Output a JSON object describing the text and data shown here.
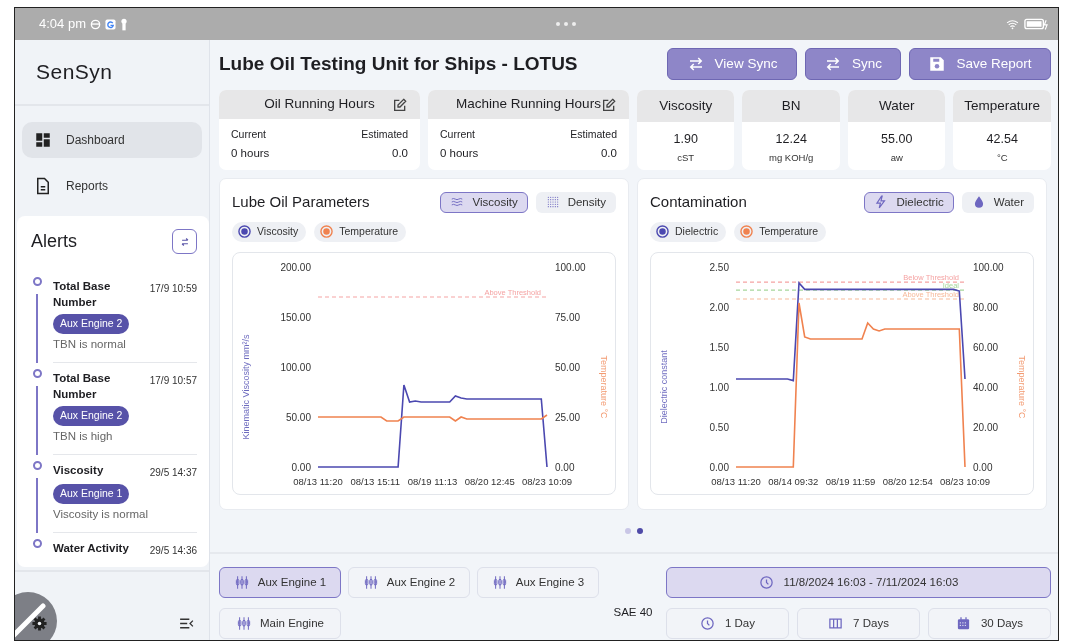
{
  "status_bar": {
    "time": "4:04 pm"
  },
  "sidebar": {
    "logo": "SenSyn",
    "nav": [
      {
        "label": "Dashboard",
        "selected": true
      },
      {
        "label": "Reports",
        "selected": false
      }
    ],
    "alerts": {
      "title": "Alerts",
      "items": [
        {
          "title": "Total Base Number",
          "time": "17/9 10:59",
          "tag": "Aux Engine 2",
          "message": "TBN is normal"
        },
        {
          "title": "Total Base Number",
          "time": "17/9 10:57",
          "tag": "Aux Engine 2",
          "message": "TBN is high"
        },
        {
          "title": "Viscosity",
          "time": "29/5 14:37",
          "tag": "Aux Engine 1",
          "message": "Viscosity is normal"
        },
        {
          "title": "Water Activity",
          "time": "29/5 14:36"
        }
      ]
    }
  },
  "header": {
    "title": "Lube Oil Testing Unit for Ships - LOTUS",
    "buttons": [
      {
        "label": "View Sync"
      },
      {
        "label": "Sync"
      },
      {
        "label": "Save Report"
      }
    ]
  },
  "hours_cards": [
    {
      "title": "Oil Running Hours",
      "current_label": "Current",
      "current": "0 hours",
      "estimated_label": "Estimated",
      "estimated": "0.0"
    },
    {
      "title": "Machine Running Hours",
      "current_label": "Current",
      "current": "0 hours",
      "estimated_label": "Estimated",
      "estimated": "0.0"
    }
  ],
  "metrics": [
    {
      "title": "Viscosity",
      "value": "1.90",
      "unit": "cST"
    },
    {
      "title": "BN",
      "value": "12.24",
      "unit": "mg KOH/g"
    },
    {
      "title": "Water",
      "value": "55.00",
      "unit": "aw"
    },
    {
      "title": "Temperature",
      "value": "42.54",
      "unit": "°C"
    }
  ],
  "charts": [
    {
      "title": "Lube Oil Parameters",
      "toggles": [
        {
          "label": "Viscosity",
          "selected": true
        },
        {
          "label": "Density",
          "selected": false
        }
      ],
      "chart_data": {
        "type": "line",
        "ylabel": "Kinematic Viscosity mm²/s",
        "y2label": "Temperature °C",
        "ylim": [
          0,
          200
        ],
        "y2lim": [
          0,
          100
        ],
        "categories": [
          "08/13 11:20",
          null,
          null,
          null,
          null,
          null,
          null,
          null,
          null,
          null,
          "08/13 15:11",
          null,
          null,
          null,
          null,
          null,
          null,
          null,
          null,
          null,
          "08/19 11:13",
          null,
          null,
          null,
          null,
          null,
          null,
          null,
          null,
          null,
          "08/20 12:45",
          null,
          null,
          null,
          null,
          null,
          null,
          null,
          null,
          null,
          "08/23 10:09"
        ],
        "yticks": [
          {
            "value": 0,
            "label": "0.00"
          },
          {
            "value": 50,
            "label": "50.00"
          },
          {
            "value": 100,
            "label": "100.00"
          },
          {
            "value": 150,
            "label": "150.00"
          },
          {
            "value": 200,
            "label": "200.00"
          }
        ],
        "y2ticks": [
          {
            "value": 0,
            "label": "0.00"
          },
          {
            "value": 25,
            "label": "25.00"
          },
          {
            "value": 50,
            "label": "50.00"
          },
          {
            "value": 75,
            "label": "75.00"
          },
          {
            "value": 100,
            "label": "100.00"
          }
        ],
        "series": [
          {
            "name": "Viscosity",
            "color": "#4b48b0",
            "values": [
              0,
              0,
              0,
              0,
              0,
              0,
              0,
              0,
              0,
              0,
              0,
              0,
              0,
              0,
              0,
              82,
              65,
              66,
              65,
              65,
              65,
              65,
              65,
              65,
              71,
              69,
              68,
              68,
              68,
              68,
              68,
              68,
              68,
              68,
              68,
              68,
              68,
              68,
              68,
              68,
              0
            ]
          },
          {
            "name": "Temperature",
            "color": "#f0824f",
            "axis": "y2",
            "values": [
              25,
              25,
              25,
              25,
              25,
              25,
              25,
              25,
              25,
              25,
              25,
              25,
              23,
              23,
              23,
              25,
              25,
              25,
              25,
              25,
              25,
              25,
              25,
              25,
              23,
              25,
              24,
              24,
              24,
              24,
              24,
              24,
              24,
              24,
              24,
              24,
              24,
              24,
              24,
              24,
              26
            ]
          }
        ],
        "ref_lines": [
          {
            "axis": "y",
            "value": 170,
            "label": "Above Threshold",
            "color": "#f5a3a3"
          }
        ]
      }
    },
    {
      "title": "Contamination",
      "toggles": [
        {
          "label": "Dielectric",
          "selected": true
        },
        {
          "label": "Water",
          "selected": false
        }
      ],
      "chart_data": {
        "type": "line",
        "ylabel": "Dielectric constant",
        "y2label": "Temperature °C",
        "ylim": [
          0,
          2.5
        ],
        "y2lim": [
          0,
          100
        ],
        "categories": [
          "08/13 11:20",
          null,
          null,
          null,
          null,
          null,
          null,
          null,
          null,
          null,
          "08/14 09:32",
          null,
          null,
          null,
          null,
          null,
          null,
          null,
          null,
          null,
          "08/19 11:59",
          null,
          null,
          null,
          null,
          null,
          null,
          null,
          null,
          null,
          "08/20 12:54",
          null,
          null,
          null,
          null,
          null,
          null,
          null,
          null,
          null,
          "08/23 10:09"
        ],
        "yticks": [
          {
            "value": 0,
            "label": "0.00"
          },
          {
            "value": 0.5,
            "label": "0.50"
          },
          {
            "value": 1,
            "label": "1.00"
          },
          {
            "value": 1.5,
            "label": "1.50"
          },
          {
            "value": 2,
            "label": "2.00"
          },
          {
            "value": 2.5,
            "label": "2.50"
          }
        ],
        "y2ticks": [
          {
            "value": 0,
            "label": "0.00"
          },
          {
            "value": 20,
            "label": "20.00"
          },
          {
            "value": 40,
            "label": "40.00"
          },
          {
            "value": 60,
            "label": "60.00"
          },
          {
            "value": 80,
            "label": "80.00"
          },
          {
            "value": 100,
            "label": "100.00"
          }
        ],
        "series": [
          {
            "name": "Dielectric",
            "color": "#4b48b0",
            "values": [
              1.1,
              1.1,
              1.1,
              1.1,
              1.1,
              1.1,
              1.1,
              1.1,
              1.1,
              1.1,
              1.08,
              2.3,
              2.22,
              2.22,
              2.22,
              2.22,
              2.22,
              2.22,
              2.22,
              2.22,
              2.22,
              2.22,
              2.22,
              2.22,
              2.22,
              2.22,
              2.22,
              2.22,
              2.22,
              2.22,
              2.22,
              2.22,
              2.22,
              2.22,
              2.22,
              2.22,
              2.22,
              2.22,
              2.22,
              2.2,
              1.1
            ]
          },
          {
            "name": "Temperature",
            "color": "#f0824f",
            "axis": "y2",
            "values": [
              0,
              0,
              0,
              0,
              0,
              0,
              0,
              0,
              0,
              0,
              0,
              82,
              65,
              64,
              64,
              64,
              64,
              64,
              64,
              64,
              64,
              64,
              64,
              72,
              69,
              68,
              69,
              69,
              69,
              69,
              69,
              69,
              69,
              69,
              69,
              69,
              69,
              69,
              69,
              69,
              0
            ]
          }
        ],
        "ref_lines": [
          {
            "axis": "y",
            "value": 2.31,
            "label": "Below Threshold",
            "color": "#f5a3a3"
          },
          {
            "axis": "y",
            "value": 2.21,
            "label": "Ideal",
            "color": "#a6d69c"
          },
          {
            "axis": "y",
            "value": 2.1,
            "label": "Above Threshold",
            "color": "#f7b99a"
          }
        ]
      }
    }
  ],
  "carousel_dots": [
    {
      "selected": false
    },
    {
      "selected": true
    }
  ],
  "engines": [
    {
      "label": "Aux Engine 1",
      "selected": true
    },
    {
      "label": "Aux Engine 2",
      "selected": false
    },
    {
      "label": "Aux Engine 3",
      "selected": false
    },
    {
      "label": "Main Engine",
      "selected": false
    }
  ],
  "oil_grade": "SAE 40",
  "date_range": "11/8/2024 16:03 - 7/11/2024 16:03",
  "ranges": [
    {
      "label": "1 Day",
      "selected": false
    },
    {
      "label": "7 Days",
      "selected": false
    },
    {
      "label": "30 Days",
      "selected": false
    }
  ]
}
